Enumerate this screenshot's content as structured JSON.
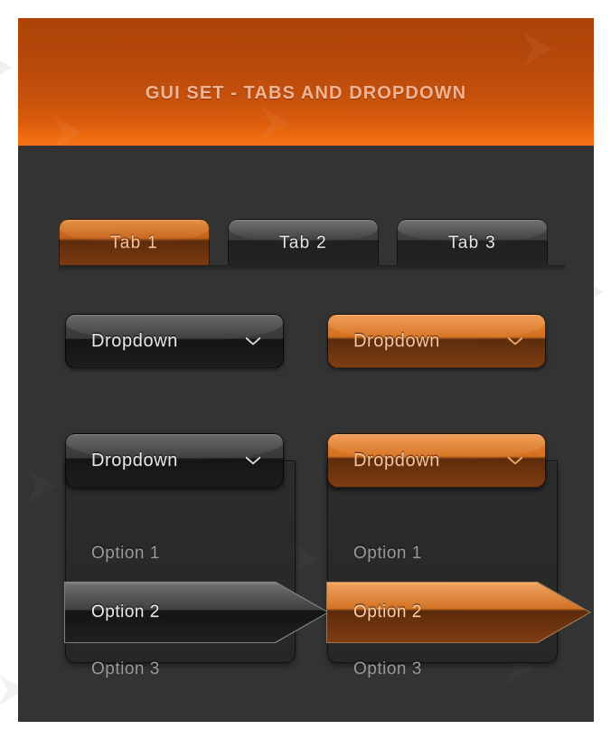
{
  "header": {
    "title": "GUI SET - TABS AND DROPDOWN",
    "title_color": "#f2b494",
    "gradient_top": "#ae4408",
    "gradient_bottom": "#f4731a"
  },
  "theme": {
    "panel_background": "#333333",
    "list_background": "#2a2a2a",
    "accent_orange": "#d4711f",
    "accent_orange_light": "#e8833a",
    "option_text": "#9b9b9b",
    "dark_button_top": "#454545",
    "dark_button_bottom": "#1d1d1d"
  },
  "tabs": [
    {
      "label": "Tab 1",
      "state": "active"
    },
    {
      "label": "Tab 2",
      "state": "inactive"
    },
    {
      "label": "Tab 3",
      "state": "inactive"
    }
  ],
  "dropdowns_closed": [
    {
      "label": "Dropdown",
      "variant": "dark",
      "icon": "chevron-down-icon"
    },
    {
      "label": "Dropdown",
      "variant": "orange",
      "icon": "chevron-down-icon"
    }
  ],
  "dropdowns_open": [
    {
      "variant": "dark",
      "button": {
        "label": "Dropdown",
        "icon": "chevron-down-icon"
      },
      "options": [
        {
          "label": "Option 1",
          "selected": false
        },
        {
          "label": "Option 2",
          "selected": true
        },
        {
          "label": "Option 3",
          "selected": false
        }
      ]
    },
    {
      "variant": "orange",
      "button": {
        "label": "Dropdown",
        "icon": "chevron-down-icon"
      },
      "options": [
        {
          "label": "Option 1",
          "selected": false
        },
        {
          "label": "Option 2",
          "selected": true
        },
        {
          "label": "Option 3",
          "selected": false
        }
      ]
    }
  ],
  "watermark": {
    "glyph": "⮞"
  }
}
